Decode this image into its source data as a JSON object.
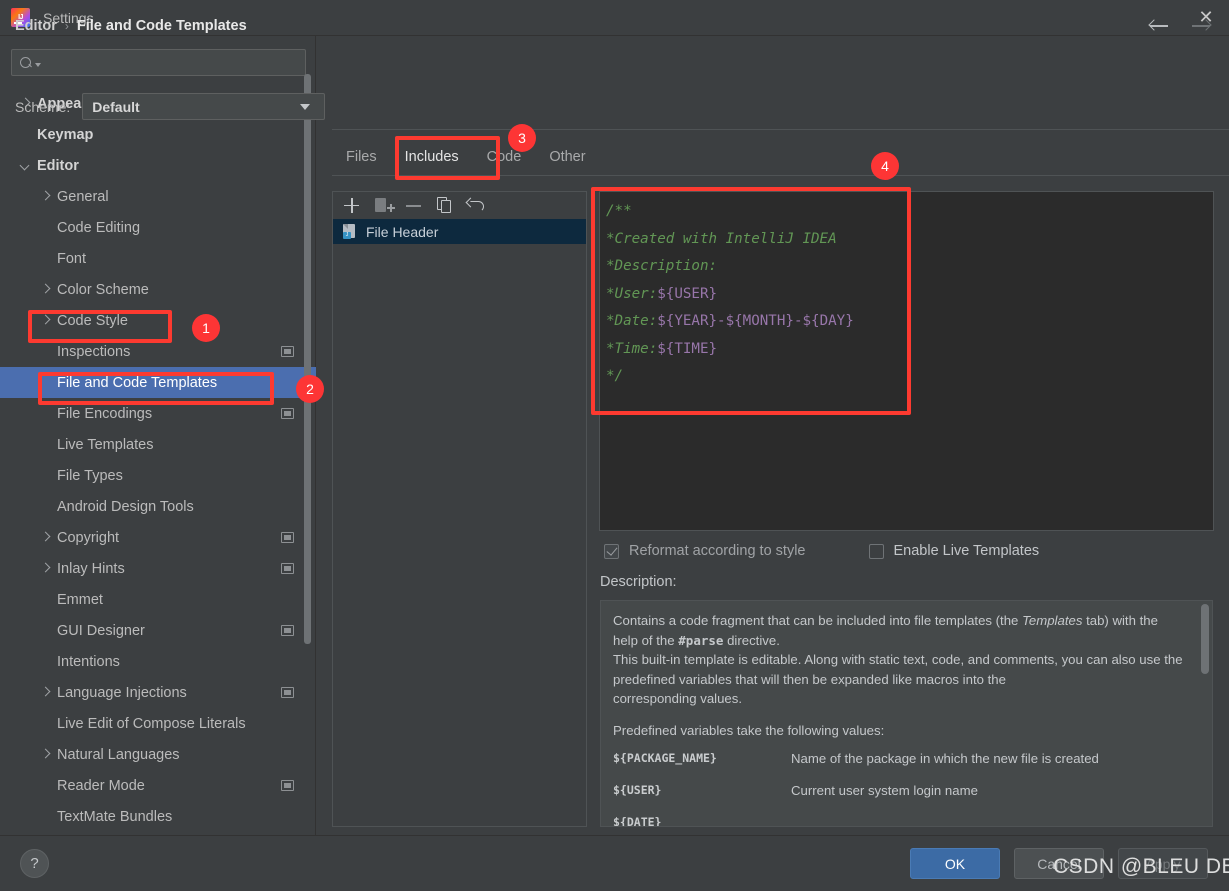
{
  "window": {
    "title": "Settings",
    "app_icon": "intellij-idea-logo",
    "close_icon": "close-icon"
  },
  "sidebar": {
    "search": {
      "placeholder": "",
      "value": "",
      "icon": "search-icon"
    },
    "items": [
      {
        "label": "Appearance & Behavior",
        "indent": 0,
        "arrow": "right",
        "bold": true,
        "badge": false,
        "selected": false
      },
      {
        "label": "Keymap",
        "indent": 0,
        "arrow": "none",
        "bold": true,
        "badge": false,
        "selected": false
      },
      {
        "label": "Editor",
        "indent": 0,
        "arrow": "down",
        "bold": true,
        "badge": false,
        "selected": false
      },
      {
        "label": "General",
        "indent": 1,
        "arrow": "right",
        "bold": false,
        "badge": false,
        "selected": false
      },
      {
        "label": "Code Editing",
        "indent": 1,
        "arrow": "none",
        "bold": false,
        "badge": false,
        "selected": false
      },
      {
        "label": "Font",
        "indent": 1,
        "arrow": "none",
        "bold": false,
        "badge": false,
        "selected": false
      },
      {
        "label": "Color Scheme",
        "indent": 1,
        "arrow": "right",
        "bold": false,
        "badge": false,
        "selected": false
      },
      {
        "label": "Code Style",
        "indent": 1,
        "arrow": "right",
        "bold": false,
        "badge": false,
        "selected": false
      },
      {
        "label": "Inspections",
        "indent": 1,
        "arrow": "none",
        "bold": false,
        "badge": true,
        "selected": false
      },
      {
        "label": "File and Code Templates",
        "indent": 1,
        "arrow": "none",
        "bold": false,
        "badge": false,
        "selected": true
      },
      {
        "label": "File Encodings",
        "indent": 1,
        "arrow": "none",
        "bold": false,
        "badge": true,
        "selected": false
      },
      {
        "label": "Live Templates",
        "indent": 1,
        "arrow": "none",
        "bold": false,
        "badge": false,
        "selected": false
      },
      {
        "label": "File Types",
        "indent": 1,
        "arrow": "none",
        "bold": false,
        "badge": false,
        "selected": false
      },
      {
        "label": "Android Design Tools",
        "indent": 1,
        "arrow": "none",
        "bold": false,
        "badge": false,
        "selected": false
      },
      {
        "label": "Copyright",
        "indent": 1,
        "arrow": "right",
        "bold": false,
        "badge": true,
        "selected": false
      },
      {
        "label": "Inlay Hints",
        "indent": 1,
        "arrow": "right",
        "bold": false,
        "badge": true,
        "selected": false
      },
      {
        "label": "Emmet",
        "indent": 1,
        "arrow": "none",
        "bold": false,
        "badge": false,
        "selected": false
      },
      {
        "label": "GUI Designer",
        "indent": 1,
        "arrow": "none",
        "bold": false,
        "badge": true,
        "selected": false
      },
      {
        "label": "Intentions",
        "indent": 1,
        "arrow": "none",
        "bold": false,
        "badge": false,
        "selected": false
      },
      {
        "label": "Language Injections",
        "indent": 1,
        "arrow": "right",
        "bold": false,
        "badge": true,
        "selected": false
      },
      {
        "label": "Live Edit of Compose Literals",
        "indent": 1,
        "arrow": "none",
        "bold": false,
        "badge": false,
        "selected": false
      },
      {
        "label": "Natural Languages",
        "indent": 1,
        "arrow": "right",
        "bold": false,
        "badge": false,
        "selected": false
      },
      {
        "label": "Reader Mode",
        "indent": 1,
        "arrow": "none",
        "bold": false,
        "badge": true,
        "selected": false
      },
      {
        "label": "TextMate Bundles",
        "indent": 1,
        "arrow": "none",
        "bold": false,
        "badge": false,
        "selected": false
      }
    ]
  },
  "header": {
    "breadcrumb_root": "Editor",
    "breadcrumb_sep": "›",
    "breadcrumb_leaf": "File and Code Templates",
    "back_icon": "arrow-left-icon",
    "forward_icon": "arrow-right-icon"
  },
  "scheme": {
    "label": "Scheme:",
    "value": "Default",
    "caret_icon": "chevron-down-icon"
  },
  "tabs": [
    {
      "label": "Files",
      "active": false
    },
    {
      "label": "Includes",
      "active": true
    },
    {
      "label": "Code",
      "active": false
    },
    {
      "label": "Other",
      "active": false
    }
  ],
  "list_toolbar": [
    {
      "icon": "plus-icon",
      "enabled": true
    },
    {
      "icon": "add-template-icon",
      "enabled": false
    },
    {
      "icon": "minus-icon",
      "enabled": false
    },
    {
      "icon": "copy-icon",
      "enabled": true
    },
    {
      "icon": "undo-reset-icon",
      "enabled": true
    }
  ],
  "templates": [
    {
      "label": "File Header",
      "icon": "template-file-icon",
      "selected": true
    }
  ],
  "editor": {
    "lines": [
      [
        {
          "t": "/**",
          "c": "comment"
        }
      ],
      [
        {
          "t": "*Created with IntelliJ IDEA",
          "c": "comment"
        }
      ],
      [
        {
          "t": "*Description:",
          "c": "comment"
        }
      ],
      [
        {
          "t": "*User:",
          "c": "comment"
        },
        {
          "t": "${USER}",
          "c": "var"
        }
      ],
      [
        {
          "t": "*Date:",
          "c": "comment"
        },
        {
          "t": "${YEAR}",
          "c": "var"
        },
        {
          "t": "-",
          "c": "var"
        },
        {
          "t": "${MONTH}",
          "c": "var"
        },
        {
          "t": "-",
          "c": "var"
        },
        {
          "t": "${DAY}",
          "c": "var"
        }
      ],
      [
        {
          "t": "*Time:",
          "c": "comment"
        },
        {
          "t": "${TIME}",
          "c": "var"
        }
      ],
      [
        {
          "t": "*/",
          "c": "comment"
        }
      ]
    ]
  },
  "options": {
    "reformat": {
      "label": "Reformat according to style",
      "checked": true,
      "enabled": false
    },
    "live_templates": {
      "label": "Enable Live Templates",
      "checked": false,
      "enabled": true
    }
  },
  "description": {
    "title": "Description:",
    "para1_a": "Contains a code fragment that can be included into file templates (the ",
    "para1_em": "Templates",
    "para1_b": " tab) with the help of the ",
    "para1_mono": "#parse",
    "para1_c": " directive.",
    "para2": "This built-in template is editable. Along with static text, code, and comments, you can also use the predefined variables that will then be expanded like macros into the",
    "para3": "corresponding values.",
    "para4": "Predefined variables take the following values:",
    "variables": [
      {
        "name": "${PACKAGE_NAME}",
        "desc": "Name of the package in which the new file is created"
      },
      {
        "name": "${USER}",
        "desc": "Current user system login name"
      },
      {
        "name": "${DATE}",
        "desc": ""
      }
    ]
  },
  "footer": {
    "help_label": "?",
    "ok_label": "OK",
    "cancel_label": "Cancel",
    "apply_label": "Apply"
  },
  "watermark": {
    "text": "CSDN @BLEU DE CHANEL"
  },
  "annotations": {
    "badges": [
      {
        "number": "1"
      },
      {
        "number": "2"
      },
      {
        "number": "3"
      },
      {
        "number": "4"
      }
    ],
    "accent_color": "#fd3a30"
  }
}
